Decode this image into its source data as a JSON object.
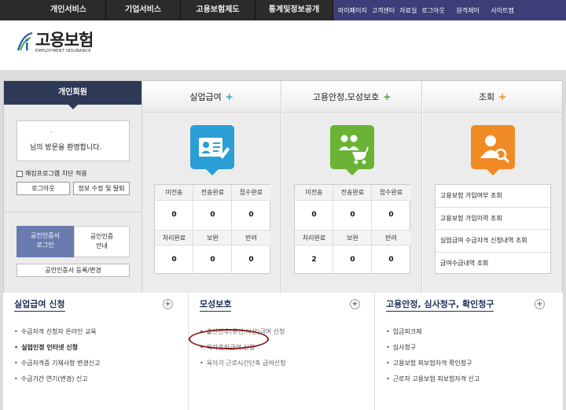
{
  "topnav": {
    "tabs": [
      "개인서비스",
      "기업서비스",
      "고용보험제도",
      "통계및정보공개"
    ],
    "util": [
      "마이페이지",
      "고객센터",
      "자료실",
      "로그아웃",
      "원격제어",
      "사이트맵"
    ]
  },
  "logo": {
    "kor": "고용보험",
    "eng": "EMPLOYMENT INSURANCE"
  },
  "login": {
    "heading": "개인회원",
    "dot": ".",
    "welcome": "님의 방문을 환영합니다.",
    "hacking_block": "해킹프로그램 차단 적용",
    "logout": "로그아웃",
    "edit_info": "정보 수정 및 탈퇴",
    "cert_login_l1": "공인인증서",
    "cert_login_l2": "로그인",
    "cert_guide_l1": "공인인증",
    "cert_guide_l2": "안내",
    "cert_register": "공인인증서 등록/변경"
  },
  "columns": [
    {
      "title": "실업급여",
      "plus": "+",
      "plus_color": "#2a9fd6",
      "icon": "id-card-icon",
      "icon_color": "#2a9fd6",
      "headers1": [
        "미전송",
        "전송완료",
        "접수완료"
      ],
      "values1": [
        "0",
        "0",
        "0"
      ],
      "headers2": [
        "처리완료",
        "보완",
        "반려"
      ],
      "values2": [
        "0",
        "0",
        "0"
      ]
    },
    {
      "title": "고용안정,모성보호",
      "plus": "+",
      "plus_color": "#4aa52e",
      "icon": "family-stroller-icon",
      "icon_color": "#6ab334",
      "headers1": [
        "미전송",
        "전송완료",
        "접수완료"
      ],
      "values1": [
        "0",
        "0",
        "0"
      ],
      "headers2": [
        "처리완료",
        "보완",
        "반려"
      ],
      "values2": [
        "2",
        "0",
        "0"
      ]
    },
    {
      "title": "조회",
      "plus": "+",
      "plus_color": "#e88a1e",
      "icon": "user-search-icon",
      "icon_color": "#f08a24",
      "items": [
        "고용보험 가입여부 조회",
        "고용보험 가입이력 조회",
        "실업급여 수급자격 신청내역 조회",
        "급여수급내역 조회"
      ]
    }
  ],
  "lists": [
    {
      "title": "실업급여 신청",
      "add": "+",
      "items": [
        "수급자격 신청자 온라인 교육",
        "실업인정 인터넷 신청",
        "수급자격증 기재사항 변경신고",
        "수급기간 연기(변경) 신고"
      ]
    },
    {
      "title": "모성보호",
      "add": "+",
      "items": [
        "출산전후(유산,사산)급여 신청",
        "육아휴직급여 신청",
        "육아기 근로시간단축 급여신청"
      ]
    },
    {
      "title": "고용안정, 심사청구, 확인청구",
      "add": "+",
      "items": [
        "임금피크제",
        "심사청구",
        "고용보험 피보험자격 확인청구",
        "근로자 고용보험 피보험자격 신고"
      ]
    }
  ]
}
